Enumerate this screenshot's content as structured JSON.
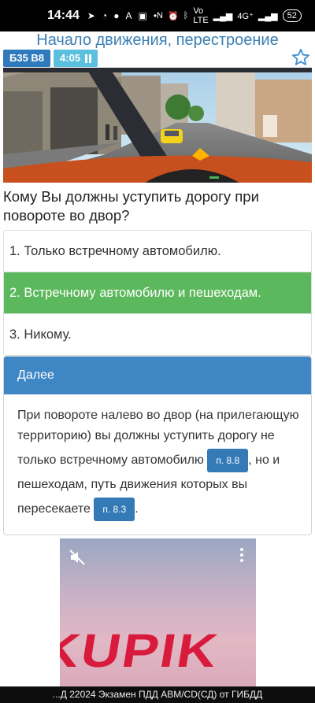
{
  "status_bar": {
    "time": "14:44",
    "battery": "52",
    "network": "4G⁺",
    "volte": "Vo LTE",
    "icons": [
      "telegram-icon",
      "sync-icon",
      "person-icon",
      "text-a-icon",
      "bag-icon",
      "dot-icon",
      "nfc-icon",
      "alarm-icon",
      "bluetooth-icon",
      "wifi-signal-icon"
    ]
  },
  "header": {
    "title": "Начало движения, перестроение",
    "ticket_badge": "Б35 В8",
    "timer": "4:05"
  },
  "question": {
    "text": "Кому Вы должны уступить дорогу при повороте во двор?"
  },
  "answers": [
    {
      "label": "1. Только встречному автомобилю."
    },
    {
      "label": "2. Встречному автомобилю и пешеходам.",
      "correct": true
    },
    {
      "label": "3. Никому."
    }
  ],
  "explanation": {
    "next_label": "Далее",
    "part1": "При повороте налево во двор (на прилегающую территорию) вы должны уступить дорогу не только встречному автомобилю ",
    "ref1": "п. 8.8",
    "part2": ", но и пешеходам, путь движения которых вы пересекаете ",
    "ref2": "п. 8.3",
    "part3": "."
  },
  "ad": {
    "logo_text": "KUPIK"
  },
  "bottom_bar": {
    "text": "...Д 22024 Экзамен ПДД ABM/CD(СД) от ГИБДД"
  },
  "colors": {
    "title_blue": "#3a7fb3",
    "ticket_badge": "#2f7abc",
    "timer_badge": "#5bc0de",
    "correct_green": "#5cb85c",
    "next_header": "#3f86c5",
    "ref_button": "#337ab7"
  }
}
